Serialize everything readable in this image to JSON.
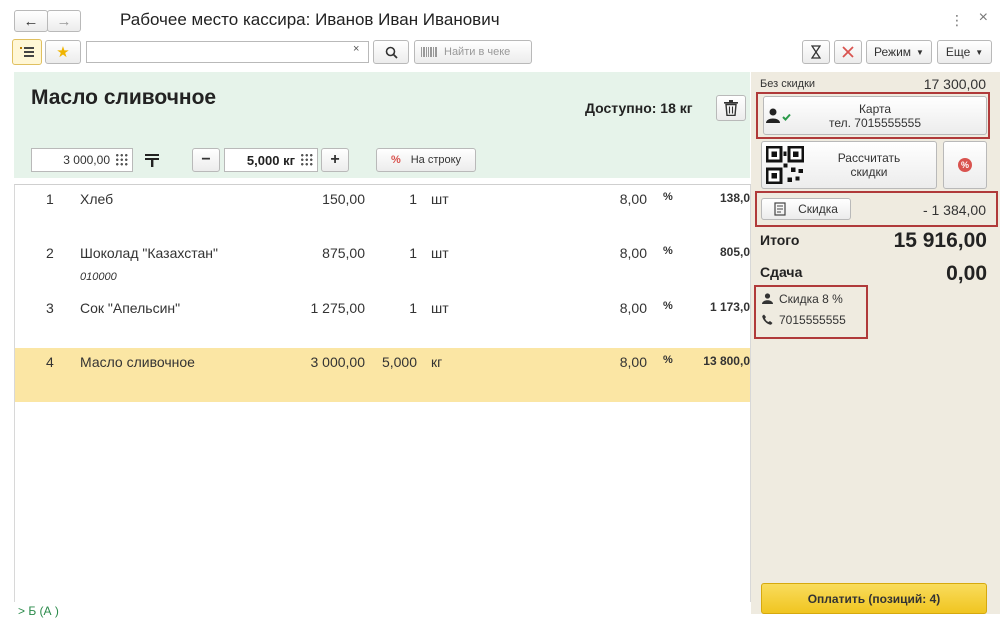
{
  "window": {
    "title": "Рабочее место кассира: Иванов  Иван  Иванович",
    "menu_icon": "⋮",
    "close_icon": "×"
  },
  "nav": {
    "back_icon": "←",
    "forward_icon": "→"
  },
  "toolbar": {
    "search_value": "",
    "clear_icon": "×",
    "find_in_receipt_label": "Найти в чеке",
    "mode_label": "Режим",
    "more_label": "Еще"
  },
  "product": {
    "name": "Масло сливочное",
    "available": "Доступно: 18 кг",
    "price": "3 000,00",
    "quantity": "5,000 кг",
    "per_line_label": "На строку",
    "percent_symbol": "%"
  },
  "receipt": {
    "rows": [
      {
        "num": "1",
        "name": "Хлеб",
        "price": "150,00",
        "qty": "1",
        "unit": "шт",
        "discount": "8,00",
        "pct": "%",
        "sum": "138,0",
        "sub": ""
      },
      {
        "num": "2",
        "name": "Шоколад \"Казахстан\"",
        "price": "875,00",
        "qty": "1",
        "unit": "шт",
        "discount": "8,00",
        "pct": "%",
        "sum": "805,0",
        "sub": "010000"
      },
      {
        "num": "3",
        "name": "Сок \"Апельсин\"",
        "price": "1 275,00",
        "qty": "1",
        "unit": "шт",
        "discount": "8,00",
        "pct": "%",
        "sum": "1 173,0",
        "sub": ""
      },
      {
        "num": "4",
        "name": "Масло сливочное",
        "price": "3 000,00",
        "qty": "5,000",
        "unit": "кг",
        "discount": "8,00",
        "pct": "%",
        "sum": "13 800,0",
        "sub": ""
      }
    ],
    "selected_row": 4
  },
  "footer": {
    "link_text": "> Б                     (А                          )"
  },
  "summary": {
    "no_discount_label": "Без скидки",
    "no_discount_value": "17 300,00",
    "card_label": "Карта",
    "card_phone": "тел. 7015555555",
    "calc_discount_label_1": "Рассчитать",
    "calc_discount_label_2": "скидки",
    "discount_label": "Скидка",
    "discount_value": "- 1 384,00",
    "total_label": "Итого",
    "total_value": "15 916,00",
    "change_label": "Сдача",
    "change_value": "0,00",
    "client_discount": "Скидка 8 %",
    "client_phone": "7015555555",
    "pay_label": "Оплатить (позиций: 4)"
  },
  "colors": {
    "accent_yellow": "#fbe6a4",
    "pay_button": "#f5cf36",
    "product_panel": "#e6f3ea",
    "highlight_border": "#b03a3a",
    "right_panel": "#efebe0",
    "red_icon": "#d9534f"
  }
}
